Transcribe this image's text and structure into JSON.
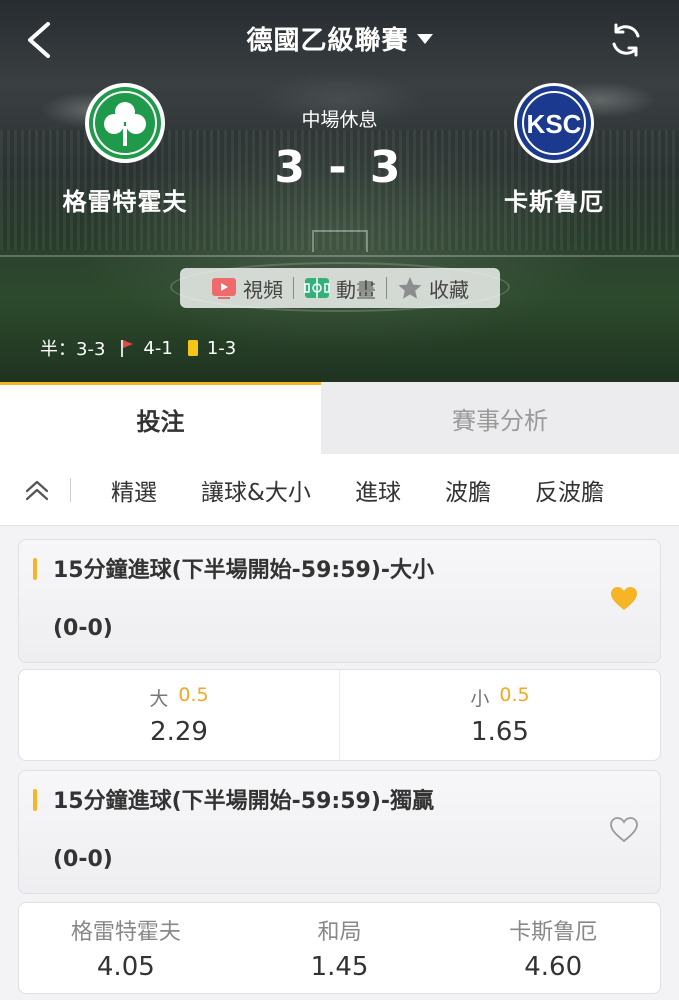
{
  "header": {
    "league": "德國乙級聯賽",
    "status": "中場休息",
    "score": "3 - 3",
    "home_team": "格雷特霍夫",
    "away_team": "卡斯鲁厄",
    "away_logo_text": "KSC",
    "media": [
      {
        "label": "視頻",
        "icon": "tv-icon"
      },
      {
        "label": "動畫",
        "icon": "pitch-icon"
      },
      {
        "label": "收藏",
        "icon": "star-icon"
      }
    ],
    "stats": {
      "half_label": "半：3-3",
      "corners": "4-1",
      "yellow_cards": "1-3"
    }
  },
  "tabs": [
    {
      "label": "投注",
      "active": true
    },
    {
      "label": "賽事分析",
      "active": false
    }
  ],
  "categories": [
    "精選",
    "讓球&大小",
    "進球",
    "波膽",
    "反波膽"
  ],
  "markets": [
    {
      "title": "15分鐘進球(下半場開始-59:59)-大小",
      "subtitle": "(0-0)",
      "favorited": true,
      "odds": [
        {
          "label": "大",
          "line": "0.5",
          "price": "2.29"
        },
        {
          "label": "小",
          "line": "0.5",
          "price": "1.65"
        }
      ]
    },
    {
      "title": "15分鐘進球(下半場開始-59:59)-獨贏",
      "subtitle": "(0-0)",
      "favorited": false,
      "odds": [
        {
          "label": "格雷特霍夫",
          "price": "4.05"
        },
        {
          "label": "和局",
          "price": "1.45"
        },
        {
          "label": "卡斯鲁厄",
          "price": "4.60"
        }
      ]
    }
  ],
  "colors": {
    "accent": "#f5b526",
    "odds_line": "#f5a623",
    "home_green": "#1f9a4a",
    "away_blue": "#1b3a8f"
  }
}
